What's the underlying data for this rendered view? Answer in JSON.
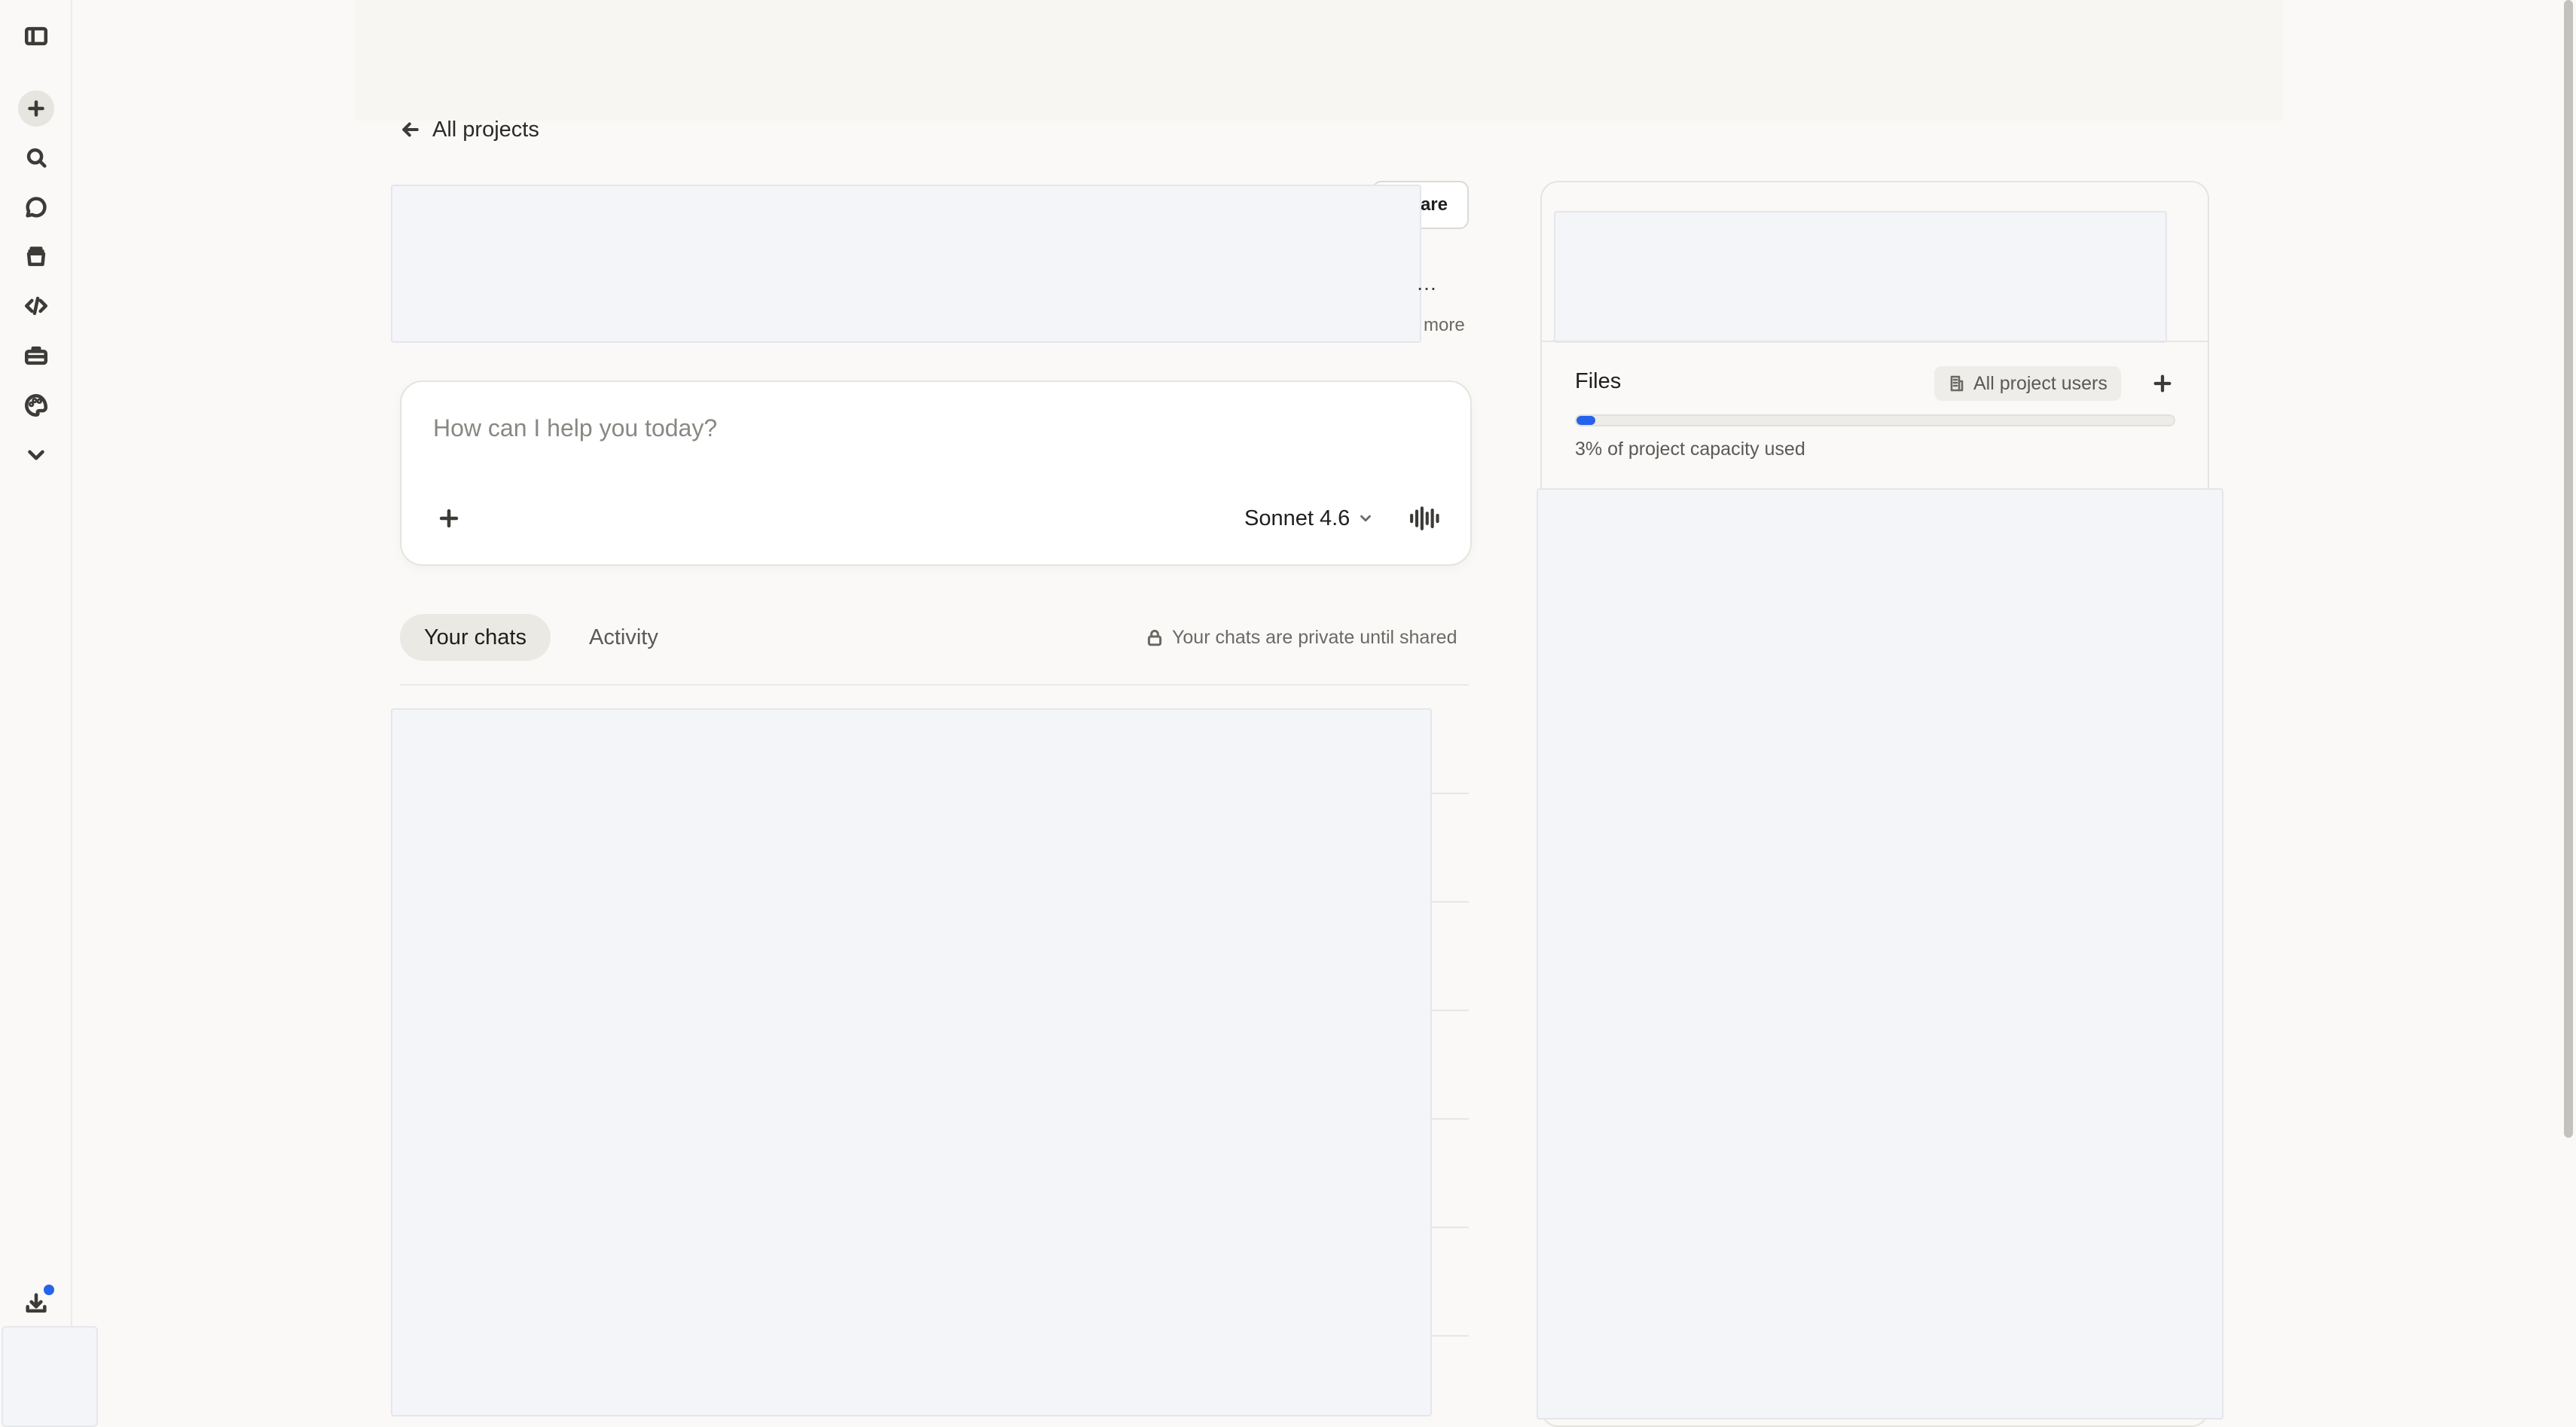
{
  "rail": {
    "icons": [
      "sidebar-toggle-icon",
      "new-chat-icon",
      "search-icon",
      "chats-icon",
      "projects-icon",
      "code-icon",
      "toolbox-icon",
      "palette-icon",
      "chevron-down-icon",
      "download-icon"
    ]
  },
  "nav": {
    "back_label": "All projects"
  },
  "header": {
    "share_label": "Share",
    "visible_share_fragment": "are",
    "description_ellipsis": "…",
    "view_more_label": "more"
  },
  "composer": {
    "placeholder": "How can I help you today?",
    "model_label": "Sonnet 4.6"
  },
  "tabs": {
    "your_chats": "Your chats",
    "activity": "Activity",
    "selected": "Your chats",
    "private_note": "Your chats are private until shared"
  },
  "panel": {
    "files_title": "Files",
    "files_scope": "All project users",
    "capacity_fraction": 0.03,
    "capacity_text": "3% of project capacity used"
  },
  "colors": {
    "accent_blue": "#2563eb",
    "background": "#faf9f7",
    "placeholder_fill": "#f4f5f8"
  }
}
